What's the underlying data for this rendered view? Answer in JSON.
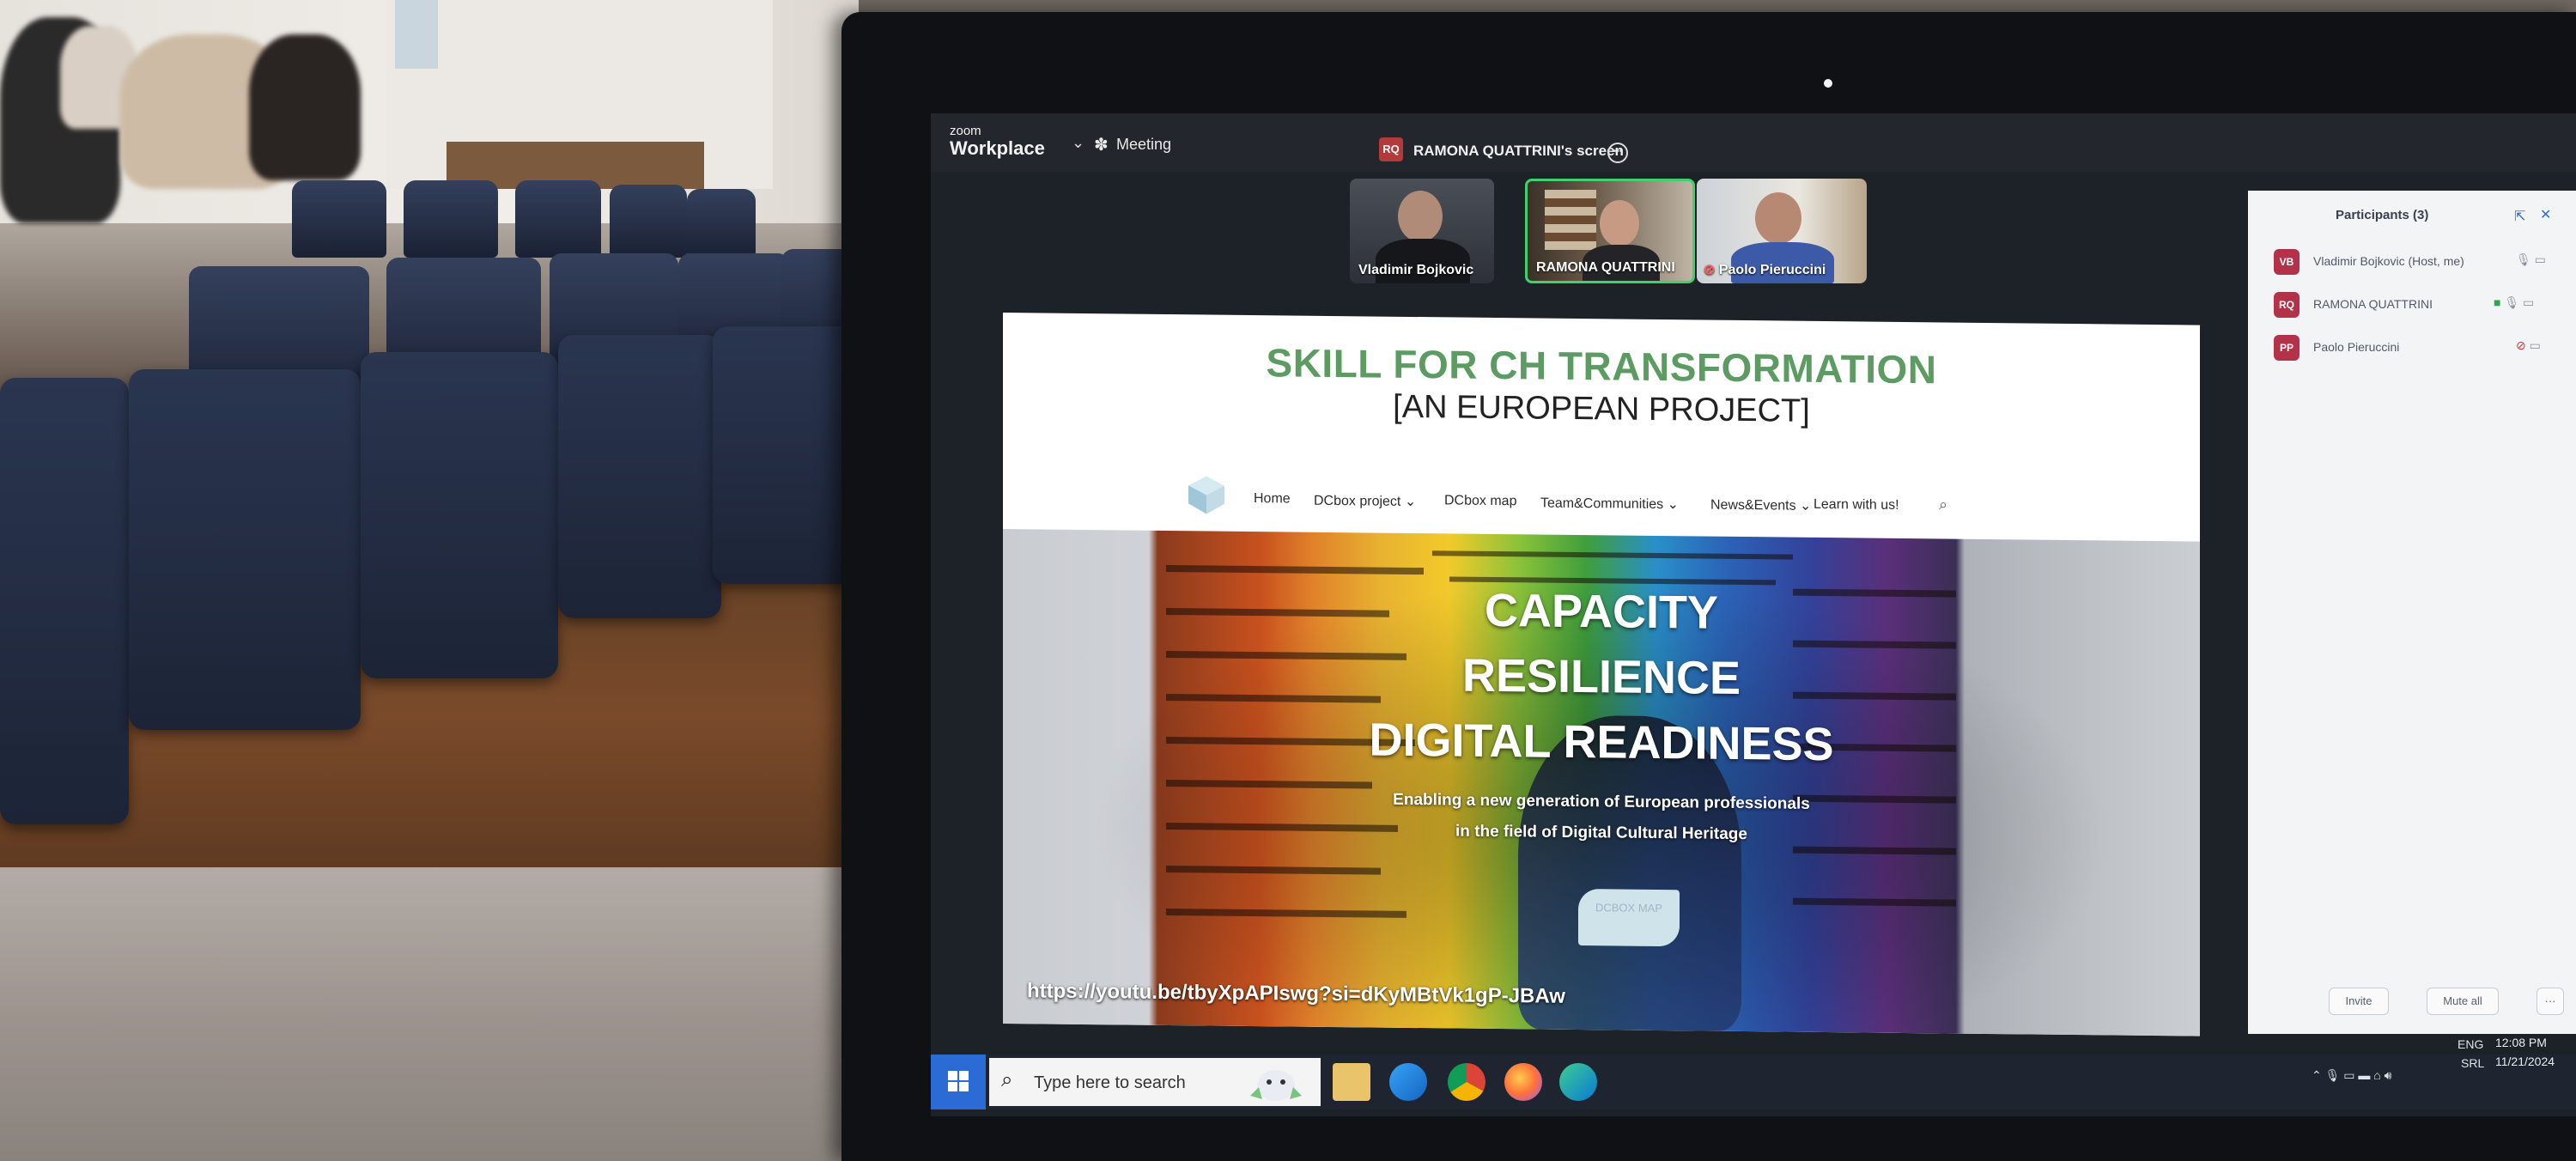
{
  "zoom": {
    "brand_top": "zoom",
    "brand": "Workplace",
    "meeting_label": "Meeting",
    "share_initials": "RQ",
    "share_label": "RAMONA QUATTRINI's screen",
    "thumbnails": [
      {
        "name": "Vladimir Bojkovic"
      },
      {
        "name": "RAMONA QUATTRINI"
      },
      {
        "name": "Paolo Pieruccini"
      }
    ]
  },
  "website": {
    "title": "SKILL FOR CH TRANSFORMATION",
    "subtitle": "[AN EUROPEAN PROJECT]",
    "nav": [
      "Home",
      "DCbox project ⌄",
      "DCbox map",
      "Team&Communities ⌄",
      "News&Events ⌄",
      "Learn with us!"
    ],
    "hero_lines": [
      "CAPACITY",
      "RESILIENCE",
      "DIGITAL READINESS"
    ],
    "hero_text_1": "Enabling a new generation of European professionals",
    "hero_text_2": "in the field of Digital Cultural Heritage",
    "hero_button": "DCBOX MAP",
    "url": "https://youtu.be/tbyXpAPIswg?si=dKyMBtVk1gP-JBAw"
  },
  "participants": {
    "title": "Participants (3)",
    "list": [
      {
        "initials": "VB",
        "name": "Vladimir Bojkovic (Host, me)"
      },
      {
        "initials": "RQ",
        "name": "RAMONA QUATTRINI"
      },
      {
        "initials": "PP",
        "name": "Paolo Pieruccini"
      }
    ],
    "invite_label": "Invite",
    "mute_all_label": "Mute all"
  },
  "taskbar": {
    "search_placeholder": "Type here to search",
    "language": "ENG",
    "region": "SRL",
    "time": "12:08 PM",
    "date": "11/21/2024"
  },
  "colors": {
    "website_title": "#5c9b61",
    "active_speaker_border": "#3fd16b",
    "avatar": "#b3324a",
    "start_button": "#2a6bd6"
  }
}
